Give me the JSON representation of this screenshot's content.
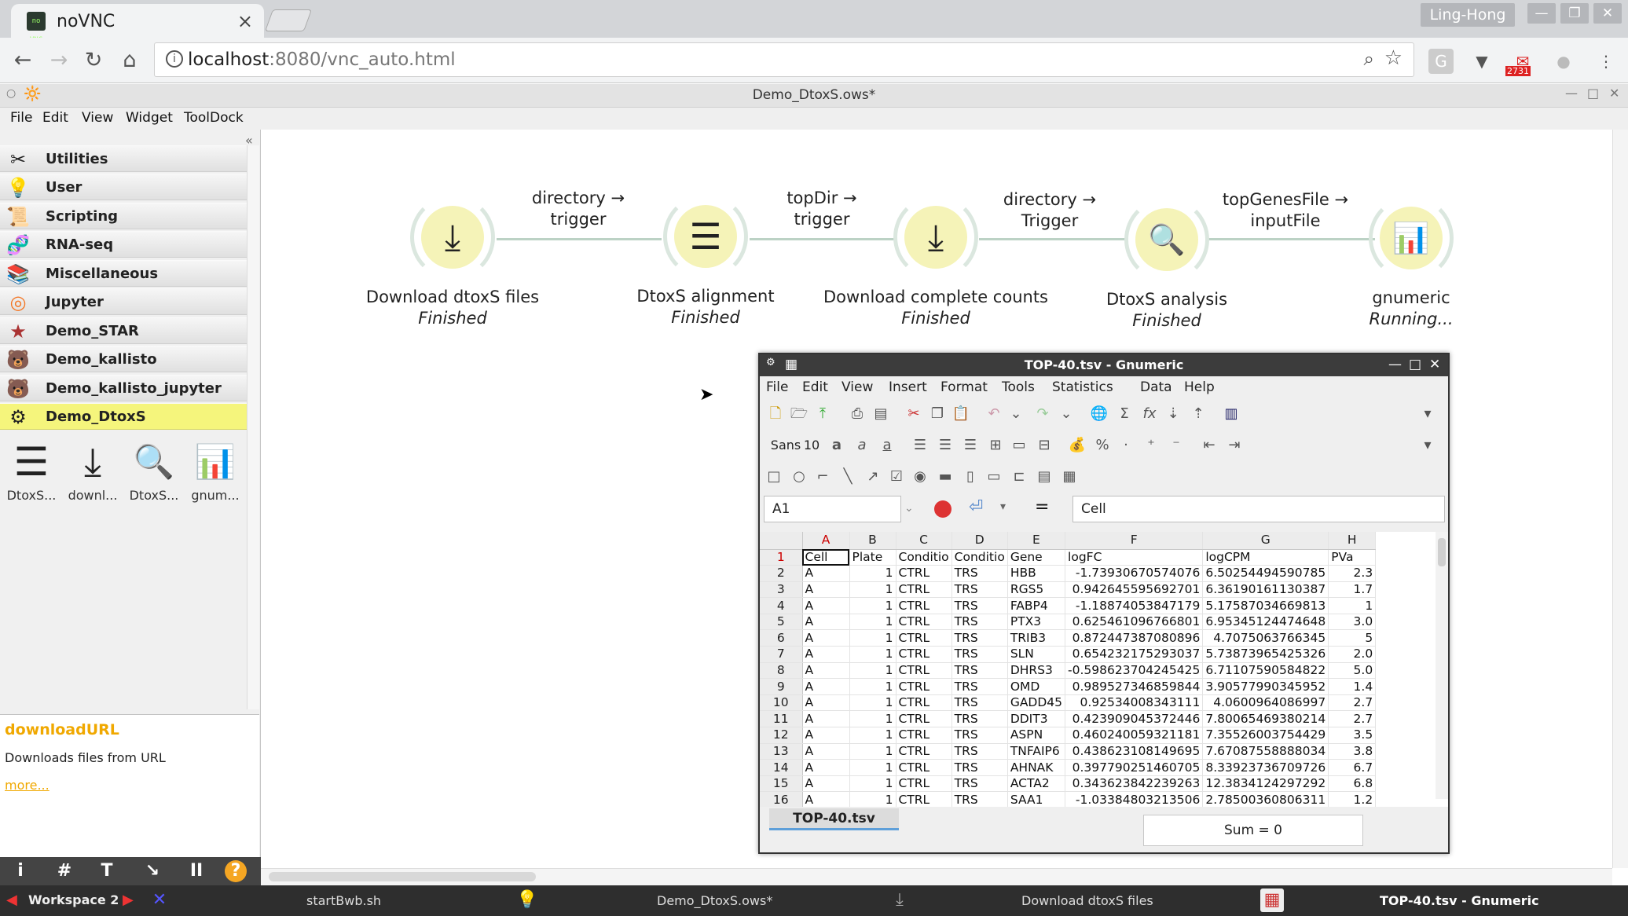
{
  "browser": {
    "tab_title": "noVNC",
    "tab_close": "×",
    "favicon_text": "no VNC",
    "user_name": "Ling-Hong",
    "url_host": "localhost",
    "url_rest": ":8080/vnc_auto.html",
    "mail_count": "2731",
    "window_controls": [
      "—",
      "❐",
      "✕"
    ]
  },
  "app": {
    "title": "Demo_DtoxS.ows*",
    "menu": [
      "File",
      "Edit",
      "View",
      "Widget",
      "ToolDock"
    ]
  },
  "sidebar": {
    "categories": [
      {
        "label": "Utilities",
        "icon": "wrench-icon",
        "glyph": "✂"
      },
      {
        "label": "User",
        "icon": "user-bulb-icon",
        "glyph": "💡"
      },
      {
        "label": "Scripting",
        "icon": "script-icon",
        "glyph": "📜"
      },
      {
        "label": "RNA-seq",
        "icon": "rnaseq-icon",
        "glyph": "🧬"
      },
      {
        "label": "Miscellaneous",
        "icon": "books-icon",
        "glyph": "📚"
      },
      {
        "label": "Jupyter",
        "icon": "jupyter-icon",
        "glyph": "◎"
      },
      {
        "label": "Demo_STAR",
        "icon": "star-icon",
        "glyph": "★"
      },
      {
        "label": "Demo_kallisto",
        "icon": "bear-icon",
        "glyph": "🐻"
      },
      {
        "label": "Demo_kallisto_jupyter",
        "icon": "kallisto-jupyter-icon",
        "glyph": "🐻"
      },
      {
        "label": "Demo_DtoxS",
        "icon": "dtoxs-icon",
        "glyph": "⚙",
        "selected": true
      }
    ],
    "tools": [
      {
        "label": "DtoxS...",
        "icon": "alignment-lines-icon",
        "glyph": "☰"
      },
      {
        "label": "downl...",
        "icon": "download-icon",
        "glyph": "⤓"
      },
      {
        "label": "DtoxS...",
        "icon": "magnifier-icon",
        "glyph": "🔍"
      },
      {
        "label": "gnum...",
        "icon": "spreadsheet-chart-icon",
        "glyph": "📊"
      }
    ],
    "help": {
      "title": "downloadURL",
      "description": "Downloads files from URL",
      "more": "more..."
    },
    "dock_buttons": [
      "i",
      "#",
      "T",
      "↘",
      "II",
      "?"
    ]
  },
  "workflow": {
    "nodes": [
      {
        "name": "Download dtoxS files",
        "status": "Finished",
        "glyph": "⤓"
      },
      {
        "name": "DtoxS alignment",
        "status": "Finished",
        "glyph": "☰"
      },
      {
        "name": "Download complete counts",
        "status": "Finished",
        "glyph": "⤓"
      },
      {
        "name": "DtoxS analysis",
        "status": "Finished",
        "glyph": "🔍"
      },
      {
        "name": "gnumeric",
        "status": "Running...",
        "glyph": "📊"
      }
    ],
    "links": [
      {
        "from_port": "directory →",
        "to_port": "trigger"
      },
      {
        "from_port": "topDir →",
        "to_port": "trigger"
      },
      {
        "from_port": "directory →",
        "to_port": "Trigger"
      },
      {
        "from_port": "topGenesFile →",
        "to_port": "inputFile"
      }
    ]
  },
  "gnumeric": {
    "title": "TOP-40.tsv - Gnumeric",
    "menu": [
      "File",
      "Edit",
      "View",
      "Insert",
      "Format",
      "Tools",
      "Statistics",
      "Data",
      "Help"
    ],
    "font_name": "Sans",
    "font_size": "10",
    "cell_ref": "A1",
    "formula_eq": "=",
    "formula_value": "Cell",
    "columns": [
      "A",
      "B",
      "C",
      "D",
      "E",
      "F",
      "G",
      "H"
    ],
    "rows": [
      [
        "1",
        "Cell",
        "Plate",
        "Conditio",
        "Conditio",
        "Gene",
        "logFC",
        "logCPM",
        "PVa"
      ],
      [
        "2",
        "A",
        "1",
        "CTRL",
        "TRS",
        "HBB",
        "-1.73930670574076",
        "6.50254494590785",
        "2.3"
      ],
      [
        "3",
        "A",
        "1",
        "CTRL",
        "TRS",
        "RGS5",
        "0.942645595692701",
        "6.36190161130387",
        "1.7"
      ],
      [
        "4",
        "A",
        "1",
        "CTRL",
        "TRS",
        "FABP4",
        "-1.18874053847179",
        "5.17587034669813",
        "1"
      ],
      [
        "5",
        "A",
        "1",
        "CTRL",
        "TRS",
        "PTX3",
        "0.625461096766801",
        "6.95345124474648",
        "3.0"
      ],
      [
        "6",
        "A",
        "1",
        "CTRL",
        "TRS",
        "TRIB3",
        "0.872447387080896",
        "4.7075063766345",
        "5"
      ],
      [
        "7",
        "A",
        "1",
        "CTRL",
        "TRS",
        "SLN",
        "0.654232175293037",
        "5.73873965425326",
        "2.0"
      ],
      [
        "8",
        "A",
        "1",
        "CTRL",
        "TRS",
        "DHRS3",
        "-0.598623704245425",
        "6.71107590584822",
        "5.0"
      ],
      [
        "9",
        "A",
        "1",
        "CTRL",
        "TRS",
        "OMD",
        "0.989527346859844",
        "3.90577990345952",
        "1.4"
      ],
      [
        "10",
        "A",
        "1",
        "CTRL",
        "TRS",
        "GADD45",
        "0.92534008343111",
        "4.0600964086997",
        "2.7"
      ],
      [
        "11",
        "A",
        "1",
        "CTRL",
        "TRS",
        "DDIT3",
        "0.423909045372446",
        "7.80065469380214",
        "2.7"
      ],
      [
        "12",
        "A",
        "1",
        "CTRL",
        "TRS",
        "ASPN",
        "0.460240059321181",
        "7.35526003754429",
        "3.5"
      ],
      [
        "13",
        "A",
        "1",
        "CTRL",
        "TRS",
        "TNFAIP6",
        "0.438623108149695",
        "7.67087558888034",
        "3.8"
      ],
      [
        "14",
        "A",
        "1",
        "CTRL",
        "TRS",
        "AHNAK",
        "0.397790251460705",
        "8.33923736709726",
        "6.7"
      ],
      [
        "15",
        "A",
        "1",
        "CTRL",
        "TRS",
        "ACTA2",
        "0.343623842239263",
        "12.3834124297292",
        "6.8"
      ],
      [
        "16",
        "A",
        "1",
        "CTRL",
        "TRS",
        "SAA1",
        "-1.03384803213506",
        "2.78500360806311",
        "1.2"
      ]
    ],
    "sheet_tab": "TOP-40.tsv",
    "status": "Sum = 0"
  },
  "taskbar": {
    "workspace": "Workspace 2",
    "tasks": [
      {
        "label": "startBwb.sh",
        "icon": "terminal-x-icon",
        "active": false
      },
      {
        "label": "Demo_DtoxS.ows*",
        "icon": "orange-bulb-icon",
        "active": false
      },
      {
        "label": "Download dtoxS files",
        "icon": "download-icon",
        "active": false
      },
      {
        "label": "TOP-40.tsv - Gnumeric",
        "icon": "gnumeric-icon",
        "active": true
      }
    ]
  }
}
